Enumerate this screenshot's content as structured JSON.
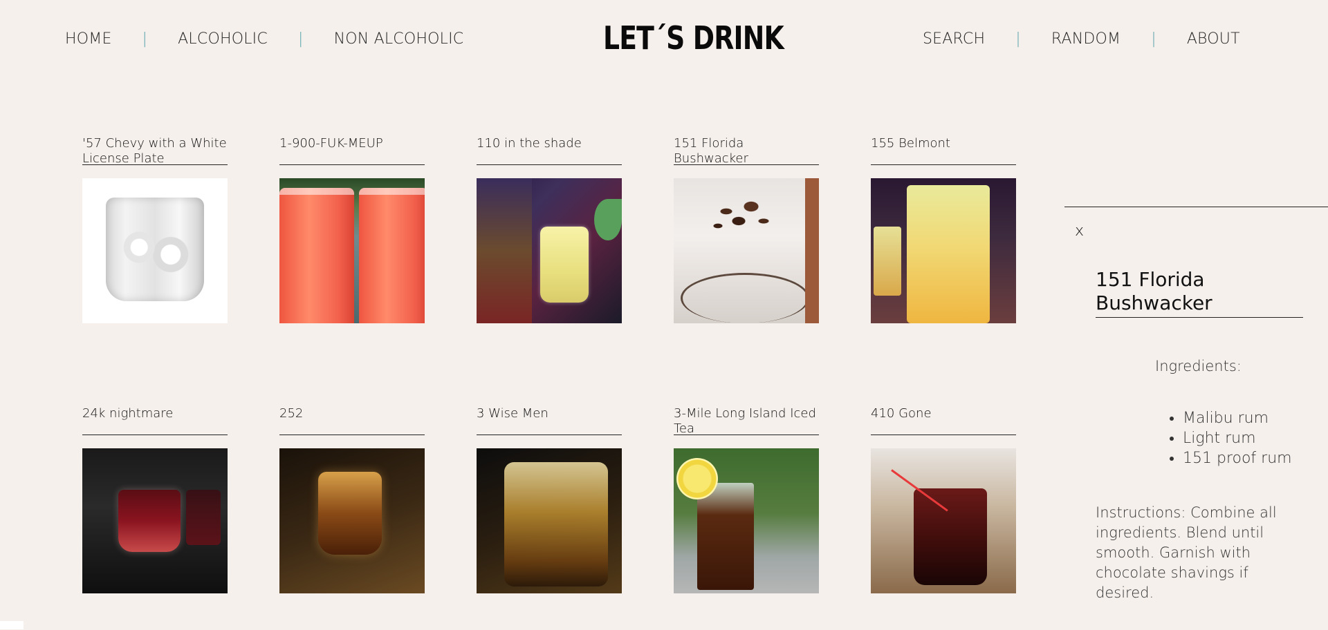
{
  "header": {
    "logo": "LET´S DRINK",
    "nav_left": [
      {
        "label": "HOME"
      },
      {
        "label": "ALCOHOLIC"
      },
      {
        "label": "NON ALCOHOLIC"
      }
    ],
    "nav_right": [
      {
        "label": "SEARCH"
      },
      {
        "label": "RANDOM"
      },
      {
        "label": "ABOUT"
      }
    ],
    "separator": "|"
  },
  "drinks": [
    {
      "name": "'57 Chevy with a White License Plate",
      "image_icon": "rocks-glass-clear"
    },
    {
      "name": "1-900-FUK-MEUP",
      "image_icon": "red-punch-cups"
    },
    {
      "name": "110 in the shade",
      "image_icon": "yellow-jar-drink"
    },
    {
      "name": "151 Florida Bushwacker",
      "image_icon": "chocolate-milkshake"
    },
    {
      "name": "155 Belmont",
      "image_icon": "orange-tall-glass"
    },
    {
      "name": "24k nightmare",
      "image_icon": "red-shot-glass"
    },
    {
      "name": "252",
      "image_icon": "amber-shot-glass"
    },
    {
      "name": "3 Wise Men",
      "image_icon": "whiskey-glass"
    },
    {
      "name": "3-Mile Long Island Iced Tea",
      "image_icon": "iced-tea-lemon"
    },
    {
      "name": "410 Gone",
      "image_icon": "red-drink-straw"
    }
  ],
  "panel": {
    "close_label": "x",
    "title": "151 Florida Bushwacker",
    "ingredients_label": "Ingredients:",
    "ingredients": [
      "Malibu rum",
      "Light rum",
      "151 proof rum"
    ],
    "instructions": "Instructions: Combine all ingredients. Blend until smooth. Garnish with chocolate shavings if desired."
  },
  "colors": {
    "background": "#f5f0ec",
    "separator": "#5aa5ad",
    "text": "#111111"
  }
}
